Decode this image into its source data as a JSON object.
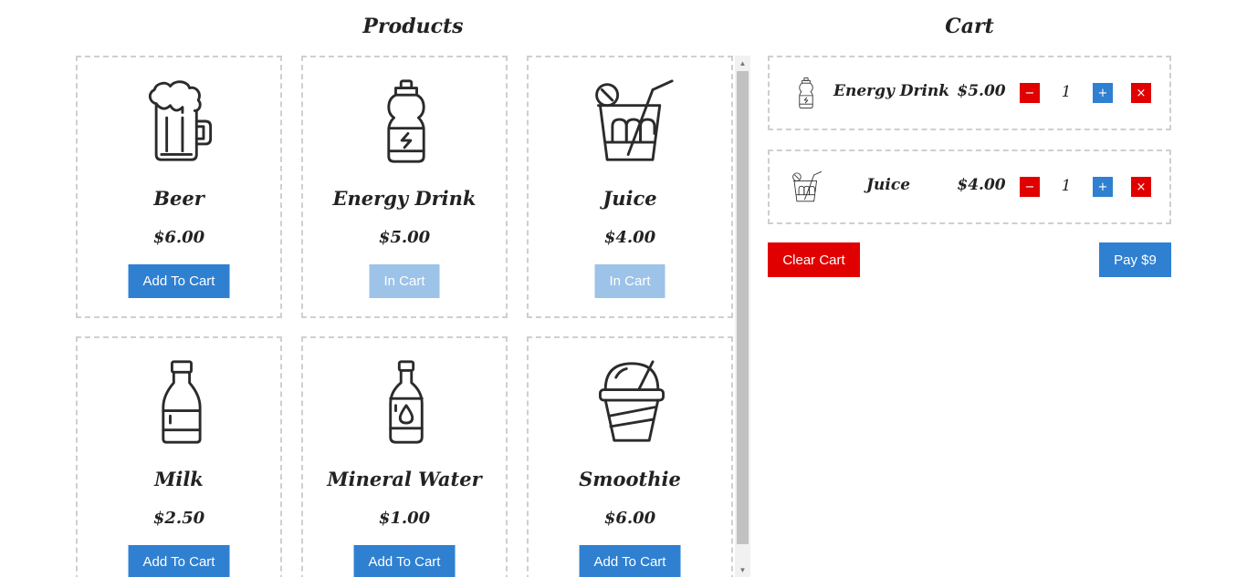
{
  "headings": {
    "products": "Products",
    "cart": "Cart"
  },
  "products": [
    {
      "name": "Beer",
      "price": "$6.00",
      "button": "Add To Cart",
      "in_cart": false,
      "icon": "beer-mug-icon"
    },
    {
      "name": "Energy Drink",
      "price": "$5.00",
      "button": "In Cart",
      "in_cart": true,
      "icon": "energy-drink-bottle-icon"
    },
    {
      "name": "Juice",
      "price": "$4.00",
      "button": "In Cart",
      "in_cart": true,
      "icon": "juice-glass-icon"
    },
    {
      "name": "Milk",
      "price": "$2.50",
      "button": "Add To Cart",
      "in_cart": false,
      "icon": "milk-bottle-icon"
    },
    {
      "name": "Mineral Water",
      "price": "$1.00",
      "button": "Add To Cart",
      "in_cart": false,
      "icon": "water-bottle-icon"
    },
    {
      "name": "Smoothie",
      "price": "$6.00",
      "button": "Add To Cart",
      "in_cart": false,
      "icon": "smoothie-cup-icon"
    }
  ],
  "cart": {
    "items": [
      {
        "name": "Energy Drink",
        "price": "$5.00",
        "qty": "1",
        "minus": "−",
        "plus": "+",
        "remove": "×",
        "icon": "energy-drink-bottle-icon"
      },
      {
        "name": "Juice",
        "price": "$4.00",
        "qty": "1",
        "minus": "−",
        "plus": "+",
        "remove": "×",
        "icon": "juice-glass-icon"
      }
    ],
    "clear_label": "Clear Cart",
    "pay_label": "Pay $9"
  },
  "colors": {
    "primary": "#2f80d1",
    "primary_disabled": "#9dc3e8",
    "danger": "#e00000",
    "border": "#cfcfcf"
  }
}
